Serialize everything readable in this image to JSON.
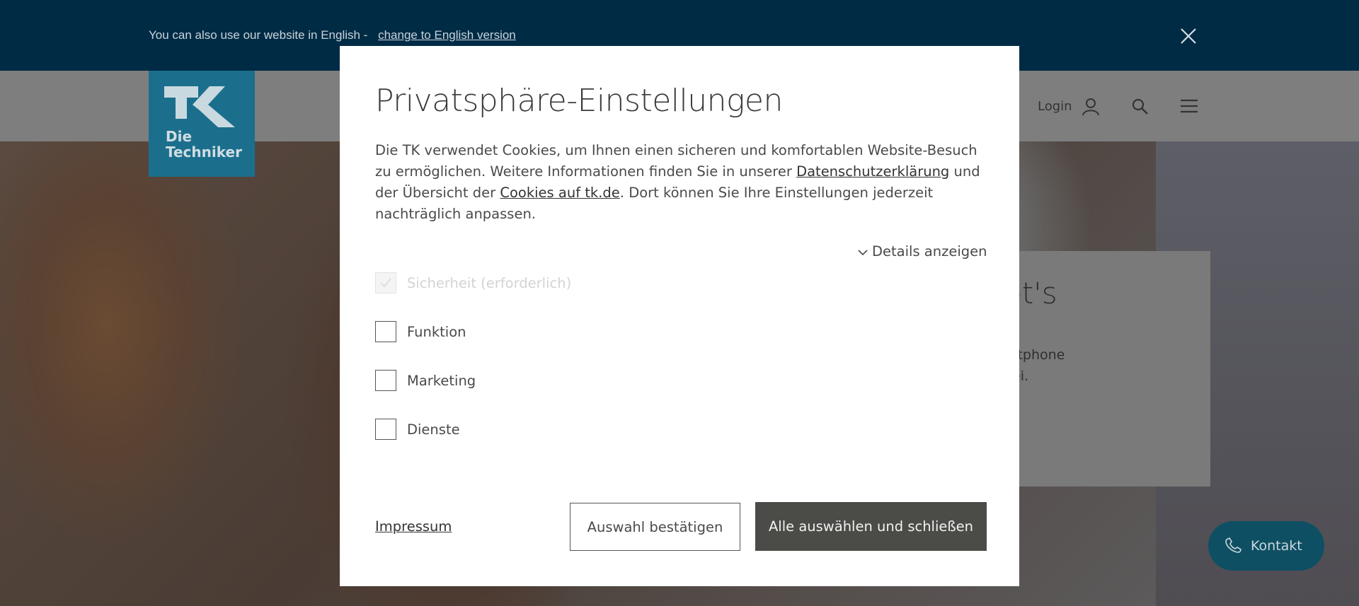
{
  "banner": {
    "text": "You can also use our website in English -",
    "link": "change to English version"
  },
  "logo": {
    "line1": "Die",
    "line2": "Techniker"
  },
  "header": {
    "login_label": "Login"
  },
  "teaser": {
    "title_fragment": "ot's",
    "body_line1": "artphone",
    "body_line2": "bei."
  },
  "kontakt": {
    "label": "Kontakt"
  },
  "modal": {
    "title": "Privatsphäre-Einstellungen",
    "text_part1": "Die TK verwendet Cookies, um Ihnen einen sicheren und komfortablen Website-Besuch zu ermöglichen. Weitere Informationen finden Sie in unserer ",
    "link_privacy": "Datenschutzerklärung",
    "text_part2": " und der Übersicht der ",
    "link_cookies": "Cookies auf tk.de",
    "text_part3": ". Dort können Sie Ihre Einstellungen jederzeit nachträglich anpassen.",
    "details_label": "Details anzeigen",
    "checkboxes": [
      {
        "label": "Sicherheit (erforderlich)",
        "checked": true,
        "disabled": true
      },
      {
        "label": "Funktion",
        "checked": false,
        "disabled": false
      },
      {
        "label": "Marketing",
        "checked": false,
        "disabled": false
      },
      {
        "label": "Dienste",
        "checked": false,
        "disabled": false
      }
    ],
    "impressum": "Impressum",
    "confirm_button": "Auswahl bestätigen",
    "accept_all_button": "Alle auswählen und schließen"
  },
  "colors": {
    "banner_bg": "#002b45",
    "logo_bg": "#1b6f8d",
    "kontakt_bg": "#0f4f63",
    "primary_button_bg": "#4b4b47"
  }
}
